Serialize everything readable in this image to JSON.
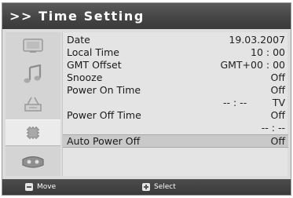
{
  "title": ">> Time Setting",
  "sidebar": {
    "icons": [
      {
        "name": "screen-icon"
      },
      {
        "name": "music-notes-icon"
      },
      {
        "name": "satellite-dish-icon"
      },
      {
        "name": "settings-chip-icon"
      },
      {
        "name": "cassette-icon"
      }
    ],
    "active_index": 3
  },
  "settings": [
    {
      "label": "Date",
      "value": "19.03.2007",
      "sub": ""
    },
    {
      "label": "Local Time",
      "value": "10 : 00",
      "sub": ""
    },
    {
      "label": "GMT Offset",
      "value": "GMT+00 : 00",
      "sub": ""
    },
    {
      "label": "Snooze",
      "value": "Off",
      "sub": ""
    },
    {
      "label": "Power On Time",
      "value": "Off",
      "sub": ""
    },
    {
      "label": "",
      "value": "TV",
      "sub": "-- : --"
    },
    {
      "label": "Power Off Time",
      "value": "Off",
      "sub": ""
    },
    {
      "label": "",
      "value": "-- : --",
      "sub": ""
    },
    {
      "label": "Auto Power Off",
      "value": "Off",
      "sub": ""
    }
  ],
  "highlighted_row": 8,
  "footer": {
    "move_label": "Move",
    "select_label": "Select"
  },
  "colors": {
    "title_bar": "#444444",
    "panel": "#e4e4e4",
    "highlight": "#c9c9c9"
  }
}
